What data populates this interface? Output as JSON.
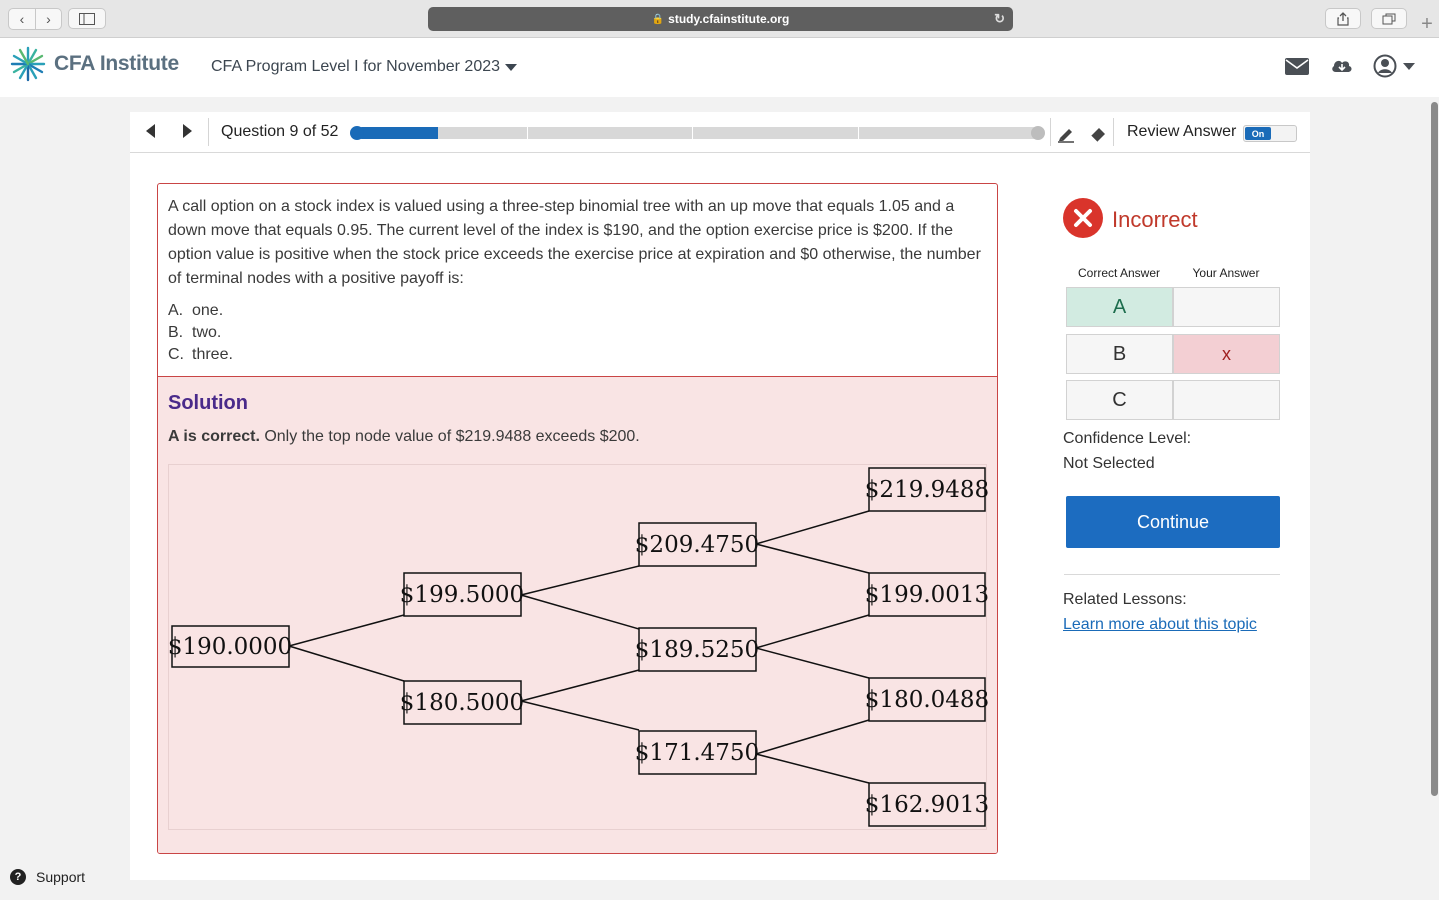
{
  "browser": {
    "url": "study.cfainstitute.org"
  },
  "header": {
    "logo_text": "CFA Institute",
    "program": "CFA Program Level I for November 2023"
  },
  "toolbar": {
    "question_label": "Question 9 of 52",
    "progress_fraction": 0.12,
    "review_answer_label": "Review Answer",
    "toggle_label": "On"
  },
  "question": {
    "stem": "A call option on a stock index is valued using a three-step binomial tree with an up move that equals 1.05 and a down move that equals 0.95. The current level of the index is $190, and the option exercise price is $200. If the option value is positive when the stock price exceeds the exercise price at expiration and $0 otherwise, the number of terminal nodes with a positive payoff is:",
    "choices": [
      {
        "letter": "A.",
        "text": "one."
      },
      {
        "letter": "B.",
        "text": "two."
      },
      {
        "letter": "C.",
        "text": "three."
      }
    ]
  },
  "solution": {
    "title": "Solution",
    "bold_text": "A is correct.",
    "text": " Only the top node value of $219.9488 exceeds $200.",
    "tree": {
      "root": "$190.0000",
      "step1": [
        "$199.5000",
        "$180.5000"
      ],
      "step2": [
        "$209.4750",
        "$189.5250",
        "$171.4750"
      ],
      "step3": [
        "$219.9488",
        "$199.0013",
        "$180.0488",
        "$162.9013"
      ]
    }
  },
  "result": {
    "label": "Incorrect",
    "correct_answer_header": "Correct Answer",
    "your_answer_header": "Your Answer",
    "rows": [
      {
        "letter": "A",
        "correct": true,
        "mark": ""
      },
      {
        "letter": "B",
        "correct": false,
        "mark": "x"
      },
      {
        "letter": "C",
        "correct": false,
        "mark": ""
      }
    ],
    "confidence_label": "Confidence Level:",
    "confidence_value": "Not Selected",
    "continue_label": "Continue",
    "related_label": "Related Lessons:",
    "related_link": "Learn more about this topic"
  },
  "support_label": "Support",
  "colors": {
    "accent": "#1a6bb8",
    "incorrect": "#d9342b",
    "solution_bg": "#f9e4e4"
  }
}
